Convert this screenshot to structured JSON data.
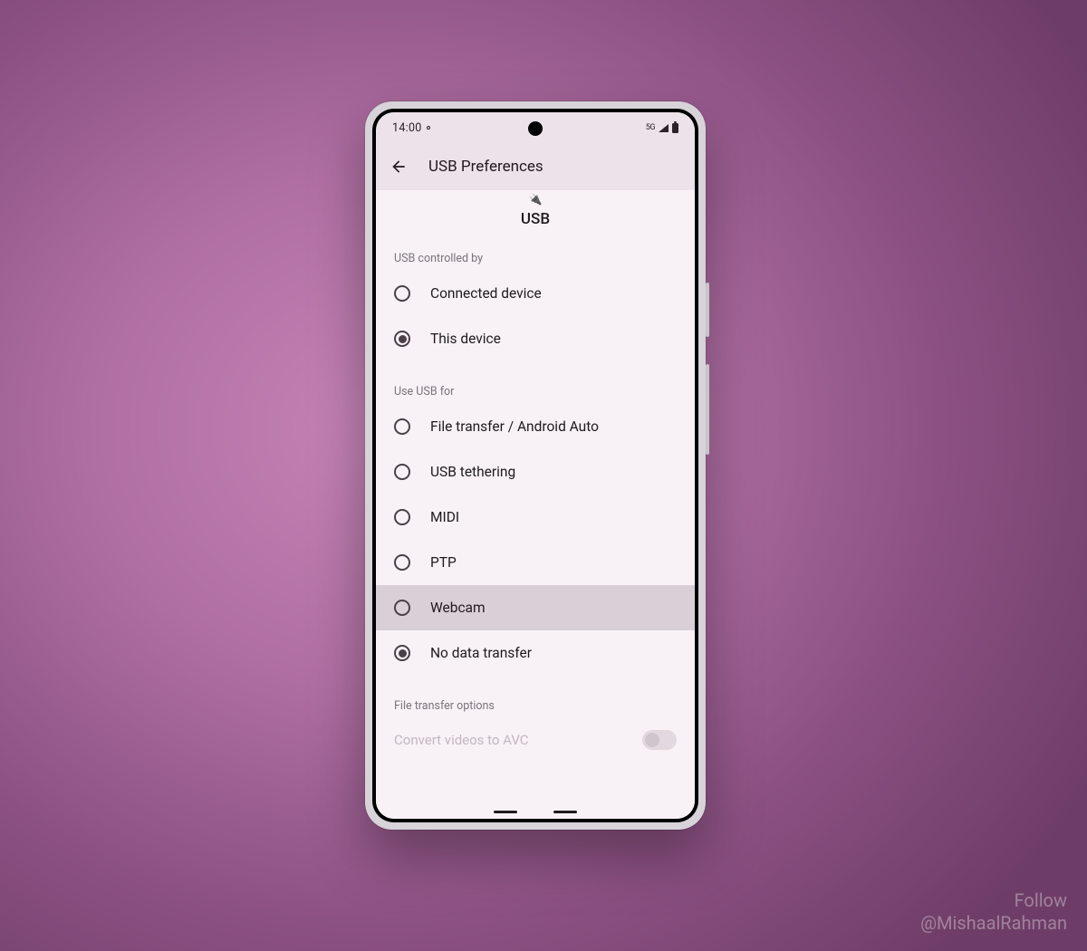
{
  "statusbar": {
    "time": "14:00",
    "network": "5G"
  },
  "appbar": {
    "title": "USB Preferences"
  },
  "header": {
    "label": "USB"
  },
  "sections": {
    "controlled_by": {
      "title": "USB controlled by",
      "options": [
        {
          "label": "Connected device",
          "checked": false
        },
        {
          "label": "This device",
          "checked": true
        }
      ]
    },
    "use_for": {
      "title": "Use USB for",
      "options": [
        {
          "label": "File transfer / Android Auto",
          "checked": false,
          "highlight": false
        },
        {
          "label": "USB tethering",
          "checked": false,
          "highlight": false
        },
        {
          "label": "MIDI",
          "checked": false,
          "highlight": false
        },
        {
          "label": "PTP",
          "checked": false,
          "highlight": false
        },
        {
          "label": "Webcam",
          "checked": false,
          "highlight": true
        },
        {
          "label": "No data transfer",
          "checked": true,
          "highlight": false
        }
      ]
    },
    "file_transfer": {
      "title": "File transfer options",
      "toggle_label": "Convert videos to AVC",
      "toggle_on": false
    }
  },
  "watermark": {
    "line1": "Follow",
    "line2": "@MishaalRahman"
  }
}
